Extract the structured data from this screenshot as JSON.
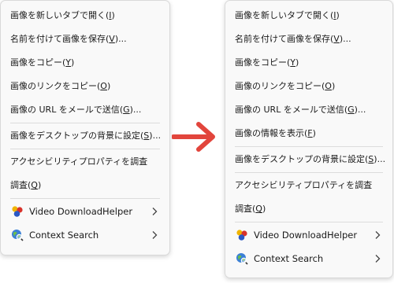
{
  "left_menu": {
    "items": [
      {
        "pre": "画像を新しいタブで開く(",
        "key": "I",
        "post": ")"
      },
      {
        "pre": "名前を付けて画像を保存(",
        "key": "V",
        "post": ")..."
      },
      {
        "pre": "画像をコピー(",
        "key": "Y",
        "post": ")"
      },
      {
        "pre": "画像のリンクをコピー(",
        "key": "O",
        "post": ")"
      },
      {
        "pre": "画像の URL をメールで送信(",
        "key": "G",
        "post": ")..."
      },
      {
        "pre": "画像をデスクトップの背景に設定(",
        "key": "S",
        "post": ")..."
      },
      {
        "pre": "アクセシビリティプロパティを調査",
        "key": "",
        "post": ""
      },
      {
        "pre": "調査(",
        "key": "Q",
        "post": ")"
      }
    ],
    "extensions": [
      {
        "label": "Video DownloadHelper",
        "icon": "video-downloadhelper-icon"
      },
      {
        "label": "Context Search",
        "icon": "context-search-icon"
      }
    ]
  },
  "right_menu": {
    "items": [
      {
        "pre": "画像を新しいタブで開く(",
        "key": "I",
        "post": ")"
      },
      {
        "pre": "名前を付けて画像を保存(",
        "key": "V",
        "post": ")..."
      },
      {
        "pre": "画像をコピー(",
        "key": "Y",
        "post": ")"
      },
      {
        "pre": "画像のリンクをコピー(",
        "key": "O",
        "post": ")"
      },
      {
        "pre": "画像の URL をメールで送信(",
        "key": "G",
        "post": ")..."
      },
      {
        "pre": "画像の情報を表示(",
        "key": "F",
        "post": ")"
      },
      {
        "pre": "画像をデスクトップの背景に設定(",
        "key": "S",
        "post": ")..."
      },
      {
        "pre": "アクセシビリティプロパティを調査",
        "key": "",
        "post": ""
      },
      {
        "pre": "調査(",
        "key": "Q",
        "post": ")"
      }
    ],
    "extensions": [
      {
        "label": "Video DownloadHelper",
        "icon": "video-downloadhelper-icon"
      },
      {
        "label": "Context Search",
        "icon": "context-search-icon"
      }
    ]
  },
  "colors": {
    "arrow": "#e2453c",
    "menu_bg": "#f9f9f9",
    "separator": "#dcdcdc",
    "text": "#1a1a1a"
  },
  "icons": {
    "arrow": "right-arrow-icon",
    "submenu": "chevron-right-icon"
  }
}
